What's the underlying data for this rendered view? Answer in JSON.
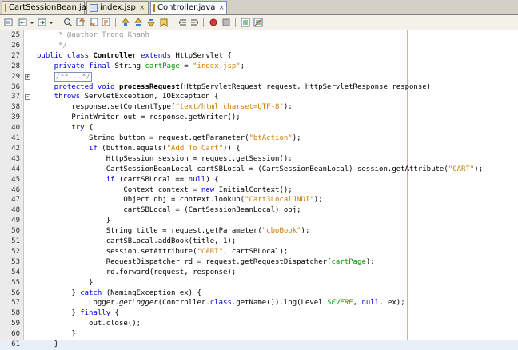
{
  "tabs": [
    {
      "label": "CartSessionBean.java",
      "kind": "java",
      "active": false
    },
    {
      "label": "index.jsp",
      "kind": "jsp",
      "active": false
    },
    {
      "label": "Controller.java",
      "kind": "java",
      "active": true
    }
  ],
  "tab_close_glyph": "×",
  "toolbar_icons": [
    "last-edit-icon",
    "back-icon",
    "forward-icon",
    "find-icon",
    "find-previous-icon",
    "find-next-icon",
    "find-selection-icon",
    "toggle-highlight-icon",
    "shift-left-icon",
    "shift-right-icon",
    "record-macro-icon",
    "stop-macro-icon",
    "toggle-bookmark-icon",
    "comment-icon",
    "uncomment-icon"
  ],
  "colors": {
    "keyword": "#0000e6",
    "string": "#ce7b00",
    "comment": "#969696",
    "field": "#009900",
    "margin_line": "#f3a0a0",
    "active_line": "#e9eff8"
  },
  "editor": {
    "lines": [
      {
        "n": "25",
        "fold": "",
        "current": false,
        "segs": [
          {
            "t": "     * @author Trong Khanh",
            "c": "cm"
          }
        ]
      },
      {
        "n": "26",
        "fold": "",
        "current": false,
        "segs": [
          {
            "t": "     */",
            "c": "cm"
          }
        ]
      },
      {
        "n": "27",
        "fold": "",
        "current": false,
        "segs": [
          {
            "t": "public class ",
            "c": "kw"
          },
          {
            "t": "Controller ",
            "c": "b"
          },
          {
            "t": "extends ",
            "c": "kw"
          },
          {
            "t": "HttpServlet {",
            "c": ""
          }
        ]
      },
      {
        "n": "28",
        "fold": "",
        "current": false,
        "segs": [
          {
            "t": "    private final ",
            "c": "kw"
          },
          {
            "t": "String ",
            "c": ""
          },
          {
            "t": "cartPage",
            "c": "fld"
          },
          {
            "t": " = ",
            "c": ""
          },
          {
            "t": "\"index.jsp\"",
            "c": "str"
          },
          {
            "t": ";",
            "c": ""
          }
        ]
      },
      {
        "n": "29",
        "fold": "+",
        "current": false,
        "segs": [
          {
            "t": "    ",
            "c": ""
          },
          {
            "t": "/**...*/",
            "c": "cmbox"
          }
        ]
      },
      {
        "n": "36",
        "fold": "",
        "current": false,
        "segs": [
          {
            "t": "    protected void ",
            "c": "kw"
          },
          {
            "t": "processRequest",
            "c": "b"
          },
          {
            "t": "(HttpServletRequest request, HttpServletResponse response)",
            "c": ""
          }
        ]
      },
      {
        "n": "37",
        "fold": "-",
        "current": false,
        "segs": [
          {
            "t": "    throws ",
            "c": "kw"
          },
          {
            "t": "ServletException, IOException {",
            "c": ""
          }
        ]
      },
      {
        "n": "38",
        "fold": "",
        "current": false,
        "segs": [
          {
            "t": "        response.setContentType(",
            "c": ""
          },
          {
            "t": "\"text/html;charset=UTF-8\"",
            "c": "str"
          },
          {
            "t": ");",
            "c": ""
          }
        ]
      },
      {
        "n": "39",
        "fold": "",
        "current": false,
        "segs": [
          {
            "t": "        PrintWriter out = response.getWriter();",
            "c": ""
          }
        ]
      },
      {
        "n": "40",
        "fold": "",
        "current": false,
        "segs": [
          {
            "t": "        try ",
            "c": "kw"
          },
          {
            "t": "{",
            "c": ""
          }
        ]
      },
      {
        "n": "41",
        "fold": "",
        "current": false,
        "segs": [
          {
            "t": "            String button = request.getParameter(",
            "c": ""
          },
          {
            "t": "\"btAction\"",
            "c": "str"
          },
          {
            "t": ");",
            "c": ""
          }
        ]
      },
      {
        "n": "42",
        "fold": "",
        "current": false,
        "segs": [
          {
            "t": "            if ",
            "c": "kw"
          },
          {
            "t": "(button.equals(",
            "c": ""
          },
          {
            "t": "\"Add To Cart\"",
            "c": "str"
          },
          {
            "t": ")) {",
            "c": ""
          }
        ]
      },
      {
        "n": "43",
        "fold": "",
        "current": false,
        "segs": [
          {
            "t": "                HttpSession session = request.getSession();",
            "c": ""
          }
        ]
      },
      {
        "n": "44",
        "fold": "",
        "current": false,
        "segs": [
          {
            "t": "                CartSessionBeanLocal cartSBLocal = (CartSessionBeanLocal) session.getAttribute(",
            "c": ""
          },
          {
            "t": "\"CART\"",
            "c": "str"
          },
          {
            "t": ");",
            "c": ""
          }
        ]
      },
      {
        "n": "45",
        "fold": "",
        "current": false,
        "segs": [
          {
            "t": "                if ",
            "c": "kw"
          },
          {
            "t": "(cartSBLocal == ",
            "c": ""
          },
          {
            "t": "null",
            "c": "kw"
          },
          {
            "t": ") {",
            "c": ""
          }
        ]
      },
      {
        "n": "46",
        "fold": "",
        "current": false,
        "segs": [
          {
            "t": "                    Context context = ",
            "c": ""
          },
          {
            "t": "new ",
            "c": "kw"
          },
          {
            "t": "InitialContext();",
            "c": ""
          }
        ]
      },
      {
        "n": "47",
        "fold": "",
        "current": false,
        "segs": [
          {
            "t": "                    Object obj = context.lookup(",
            "c": ""
          },
          {
            "t": "\"Cart3LocalJNDI\"",
            "c": "str"
          },
          {
            "t": ");",
            "c": ""
          }
        ]
      },
      {
        "n": "48",
        "fold": "",
        "current": false,
        "segs": [
          {
            "t": "                    cartSBLocal = (CartSessionBeanLocal) obj;",
            "c": ""
          }
        ]
      },
      {
        "n": "49",
        "fold": "",
        "current": false,
        "segs": [
          {
            "t": "                }",
            "c": ""
          }
        ]
      },
      {
        "n": "50",
        "fold": "",
        "current": false,
        "segs": [
          {
            "t": "                String title = request.getParameter(",
            "c": ""
          },
          {
            "t": "\"cboBook\"",
            "c": "str"
          },
          {
            "t": ");",
            "c": ""
          }
        ]
      },
      {
        "n": "51",
        "fold": "",
        "current": false,
        "segs": [
          {
            "t": "                cartSBLocal.addBook(title, 1);",
            "c": ""
          }
        ]
      },
      {
        "n": "52",
        "fold": "",
        "current": false,
        "segs": [
          {
            "t": "                session.setAttribute(",
            "c": ""
          },
          {
            "t": "\"CART\"",
            "c": "str"
          },
          {
            "t": ", cartSBLocal);",
            "c": ""
          }
        ]
      },
      {
        "n": "53",
        "fold": "",
        "current": false,
        "segs": [
          {
            "t": "                RequestDispatcher rd = request.getRequestDispatcher(",
            "c": ""
          },
          {
            "t": "cartPage",
            "c": "fld"
          },
          {
            "t": ");",
            "c": ""
          }
        ]
      },
      {
        "n": "54",
        "fold": "",
        "current": false,
        "segs": [
          {
            "t": "                rd.forward(request, response);",
            "c": ""
          }
        ]
      },
      {
        "n": "55",
        "fold": "",
        "current": false,
        "segs": [
          {
            "t": "            }",
            "c": ""
          }
        ]
      },
      {
        "n": "56",
        "fold": "",
        "current": false,
        "segs": [
          {
            "t": "        } ",
            "c": ""
          },
          {
            "t": "catch ",
            "c": "kw"
          },
          {
            "t": "(NamingException ex) {",
            "c": ""
          }
        ]
      },
      {
        "n": "57",
        "fold": "",
        "current": false,
        "segs": [
          {
            "t": "            Logger.",
            "c": ""
          },
          {
            "t": "getLogger",
            "c": "it"
          },
          {
            "t": "(Controller.",
            "c": ""
          },
          {
            "t": "class",
            "c": "kw"
          },
          {
            "t": ".getName()).log(Level.",
            "c": ""
          },
          {
            "t": "SEVERE",
            "c": "fldit"
          },
          {
            "t": ", ",
            "c": ""
          },
          {
            "t": "null",
            "c": "kw"
          },
          {
            "t": ", ex);",
            "c": ""
          }
        ]
      },
      {
        "n": "58",
        "fold": "",
        "current": false,
        "segs": [
          {
            "t": "        } ",
            "c": ""
          },
          {
            "t": "finally ",
            "c": "kw"
          },
          {
            "t": "{",
            "c": ""
          }
        ]
      },
      {
        "n": "59",
        "fold": "",
        "current": false,
        "segs": [
          {
            "t": "            out.close();",
            "c": ""
          }
        ]
      },
      {
        "n": "60",
        "fold": "",
        "current": false,
        "segs": [
          {
            "t": "        }",
            "c": ""
          }
        ]
      },
      {
        "n": "61",
        "fold": "",
        "current": true,
        "segs": [
          {
            "t": "    }",
            "c": ""
          }
        ]
      }
    ]
  }
}
